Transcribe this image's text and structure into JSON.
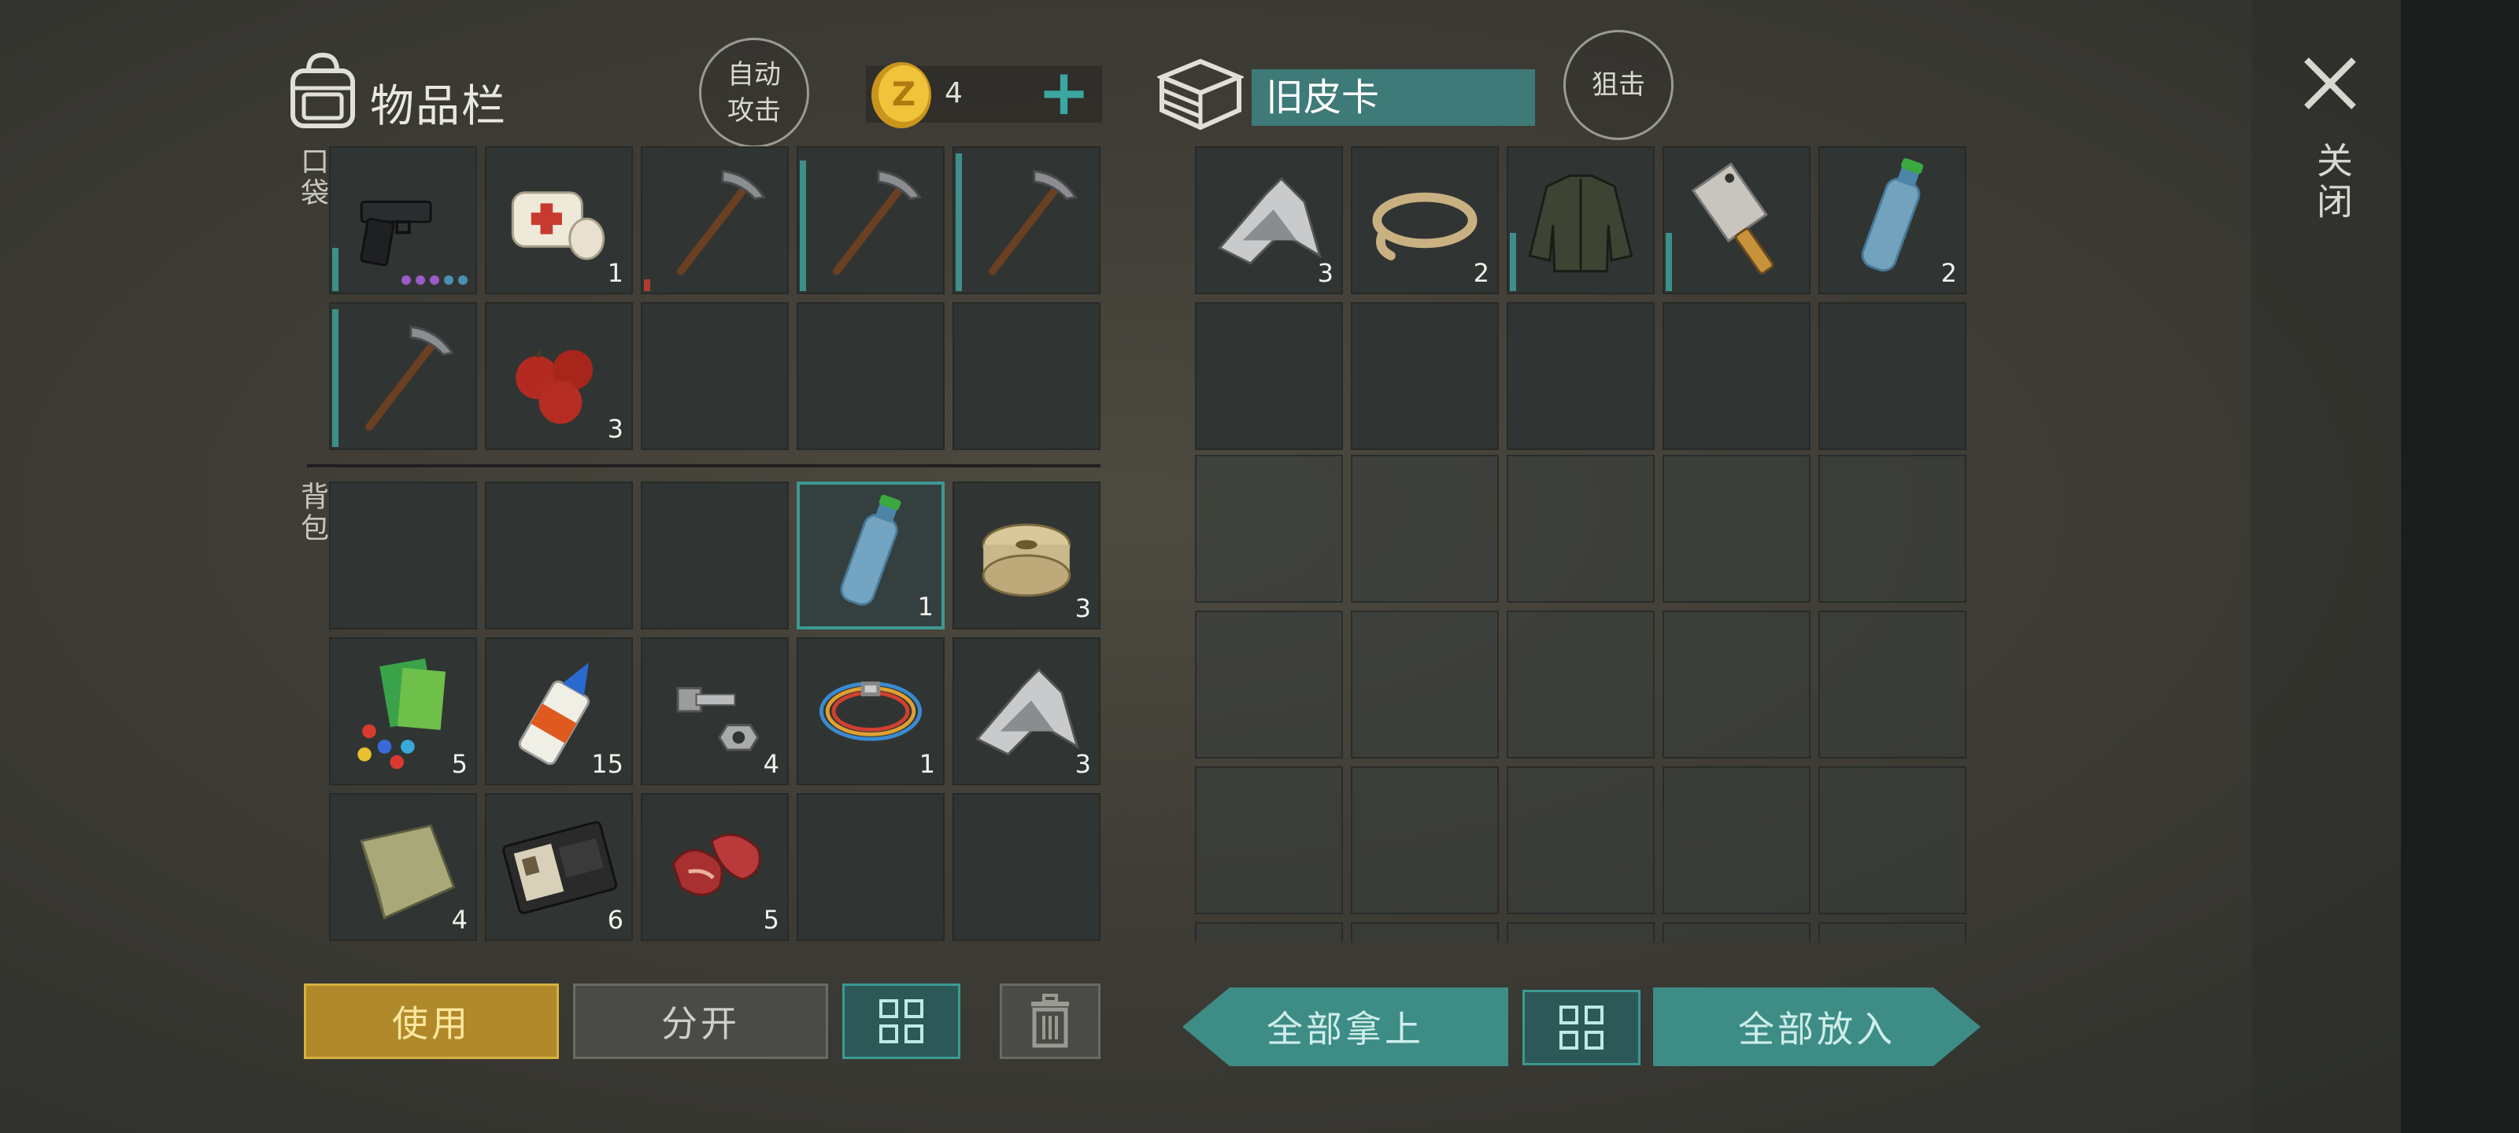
{
  "inventory": {
    "title": "物品栏",
    "auto_attack": [
      "自动",
      "攻击"
    ],
    "coins": "4",
    "plus": "+",
    "pockets_label": "口袋",
    "backpack_label": "背包"
  },
  "container": {
    "name": "旧皮卡",
    "snipe": "狙击"
  },
  "close": {
    "label": "关闭"
  },
  "pockets": [
    {
      "item": "pistol",
      "count": "",
      "durability": 0.3,
      "dots": [
        "#9b5ac8",
        "#9b5ac8",
        "#9b5ac8",
        "#4a8fb4",
        "#4a8fb4"
      ]
    },
    {
      "item": "bandage",
      "count": "1"
    },
    {
      "item": "pickaxe",
      "count": "",
      "durability": 0.08,
      "durability_color": "red"
    },
    {
      "item": "pickaxe",
      "count": "",
      "durability": 0.9
    },
    {
      "item": "pickaxe",
      "count": "",
      "durability": 0.95
    },
    {
      "item": "pickaxe",
      "count": "",
      "durability": 0.95
    },
    {
      "item": "apples",
      "count": "3"
    },
    {
      "item": "",
      "count": ""
    },
    {
      "item": "",
      "count": ""
    },
    {
      "item": "",
      "count": ""
    }
  ],
  "backpack": [
    {
      "item": "",
      "count": ""
    },
    {
      "item": "",
      "count": ""
    },
    {
      "item": "",
      "count": ""
    },
    {
      "item": "water-bottle",
      "count": "1",
      "selected": true
    },
    {
      "item": "wire-spool",
      "count": "3"
    },
    {
      "item": "parts",
      "count": "5"
    },
    {
      "item": "glue",
      "count": "15"
    },
    {
      "item": "bolt-nut",
      "count": "4"
    },
    {
      "item": "cable",
      "count": "1"
    },
    {
      "item": "scrap-metal",
      "count": "3"
    },
    {
      "item": "cloth",
      "count": "4"
    },
    {
      "item": "wallet",
      "count": "6"
    },
    {
      "item": "raw-meat",
      "count": "5"
    },
    {
      "item": "",
      "count": ""
    },
    {
      "item": "",
      "count": ""
    }
  ],
  "container_slots": [
    {
      "item": "scrap-metal",
      "count": "3"
    },
    {
      "item": "rope",
      "count": "2"
    },
    {
      "item": "jacket",
      "count": "",
      "durability": 0.4
    },
    {
      "item": "cleaver",
      "count": "",
      "durability": 0.4,
      "dots": [
        "#333",
        "#333",
        "#333"
      ]
    },
    {
      "item": "water-bottle",
      "count": "2"
    }
  ],
  "buttons": {
    "use": "使用",
    "split": "分开",
    "take_all": "全部拿上",
    "put_all": "全部放入"
  },
  "colors": {
    "accent_teal": "#3e8c86",
    "use_gold": "#b08a2a",
    "durability_teal": "#3d8f8a",
    "durability_red": "#b33a2e"
  }
}
